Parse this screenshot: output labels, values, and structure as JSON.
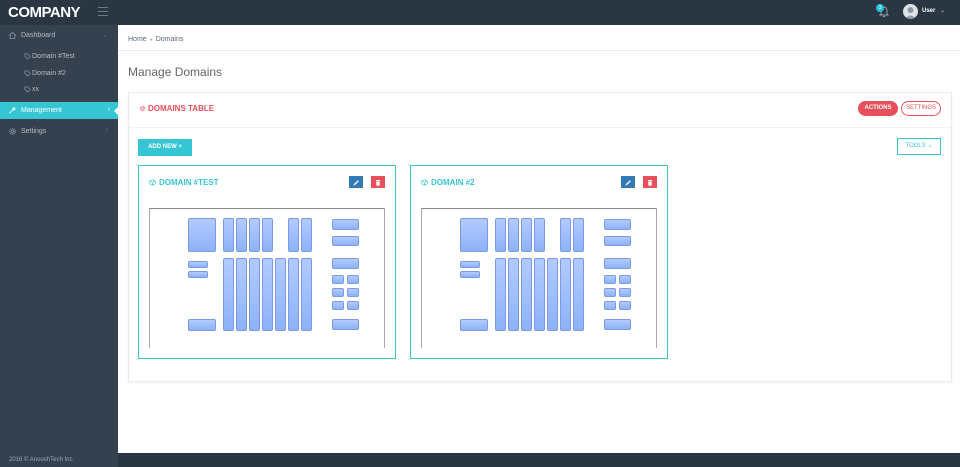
{
  "header": {
    "logo": "COMPANY",
    "notifications": "3",
    "user": "User"
  },
  "sidebar": {
    "items": [
      {
        "label": "Dashboard"
      },
      {
        "label": "Domain #Test"
      },
      {
        "label": "Domain #2"
      },
      {
        "label": "xx"
      },
      {
        "label": "Management"
      },
      {
        "label": "Settings"
      }
    ],
    "footer": "2016 © AnooshTech Inc."
  },
  "breadcrumb": {
    "home": "Home",
    "current": "Domains"
  },
  "page": {
    "title": "Manage Domains"
  },
  "portlet": {
    "title": "DOMAINS TABLE",
    "actions_label": "ACTIONS",
    "settings_label": "SETTINGS",
    "add_label": "ADD NEW +",
    "tools_label": "TOOLS"
  },
  "domains": [
    {
      "name": "DOMAIN #TEST"
    },
    {
      "name": "DOMAIN #2"
    }
  ],
  "colors": {
    "accent": "#36c6d3",
    "danger": "#e7505a",
    "primary": "#337ab7",
    "sidebar": "#364150",
    "header": "#2b3643"
  }
}
